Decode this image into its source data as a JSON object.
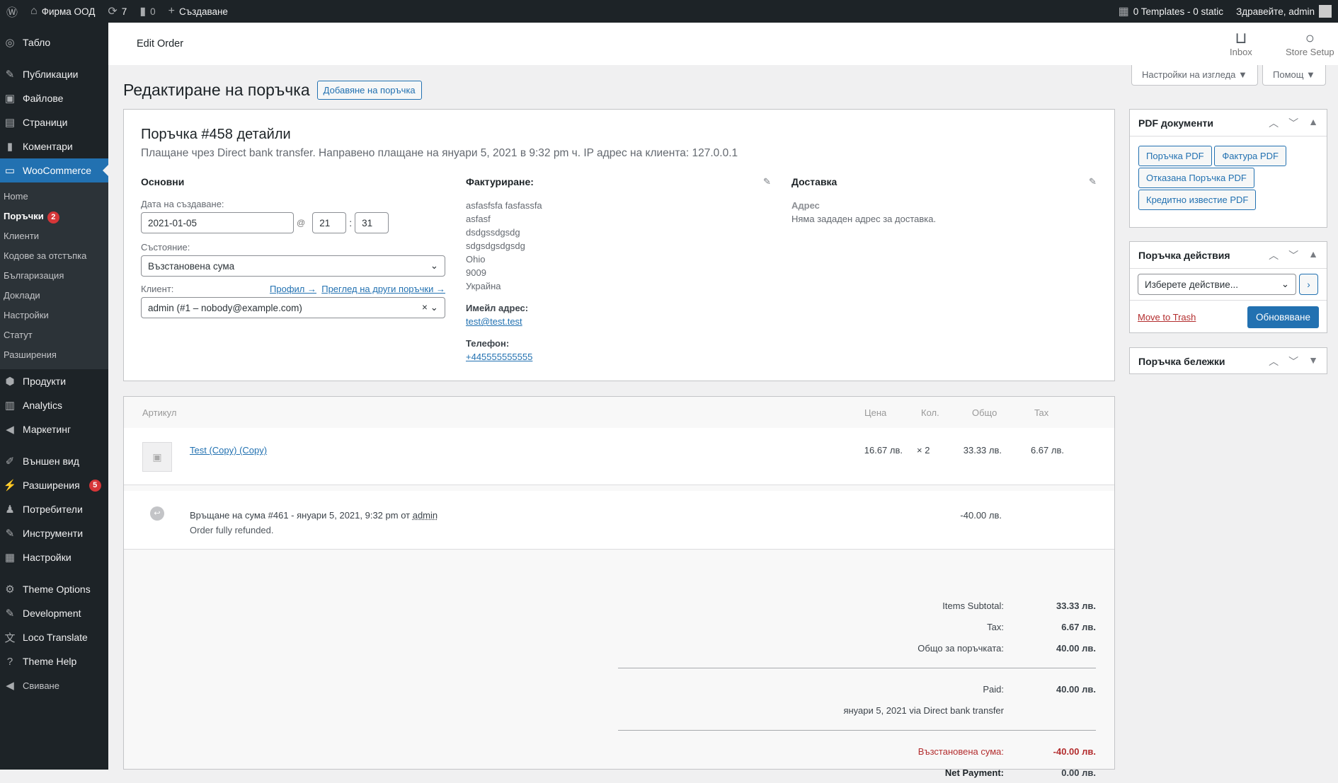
{
  "adminbar": {
    "site": "Фирма ООД",
    "updates": "7",
    "comments": "0",
    "new": "Създаване",
    "templates": "0 Templates - 0 static",
    "greeting": "Здравейте, admin"
  },
  "sidebar": {
    "top": [
      {
        "label": "Табло",
        "icon": "dashboard-icon"
      }
    ],
    "group1": [
      {
        "label": "Публикации",
        "icon": "pin-icon"
      },
      {
        "label": "Файлове",
        "icon": "media-icon"
      },
      {
        "label": "Страници",
        "icon": "page-icon"
      },
      {
        "label": "Коментари",
        "icon": "comment-icon"
      }
    ],
    "woo": "WooCommerce",
    "sub": [
      {
        "label": "Home"
      },
      {
        "label": "Поръчки",
        "badge": "2"
      },
      {
        "label": "Клиенти"
      },
      {
        "label": "Кодове за отстъпка"
      },
      {
        "label": "Българизация"
      },
      {
        "label": "Доклади"
      },
      {
        "label": "Настройки"
      },
      {
        "label": "Статут"
      },
      {
        "label": "Разширения"
      }
    ],
    "group2": [
      {
        "label": "Продукти"
      },
      {
        "label": "Analytics"
      },
      {
        "label": "Маркетинг"
      }
    ],
    "group3": [
      {
        "label": "Външен вид"
      },
      {
        "label": "Разширения",
        "badge": "5"
      },
      {
        "label": "Потребители"
      },
      {
        "label": "Инструменти"
      },
      {
        "label": "Настройки"
      }
    ],
    "group4": [
      {
        "label": "Theme Options"
      },
      {
        "label": "Development"
      },
      {
        "label": "Loco Translate"
      },
      {
        "label": "Theme Help"
      }
    ],
    "collapse": "Свиване"
  },
  "header": {
    "title": "Edit Order",
    "inbox": "Inbox",
    "store_setup": "Store Setup",
    "screen_options": "Настройки на изгледа ▼",
    "help": "Помощ ▼"
  },
  "page": {
    "title": "Редактиране на поръчка",
    "add_button": "Добавяне на поръчка"
  },
  "order": {
    "heading": "Поръчка #458 детайли",
    "meta": "Плащане чрез Direct bank transfer. Направено плащане на януари 5, 2021 в 9:32 pm ч. IP адрес на клиента: 127.0.0.1",
    "general": {
      "title": "Основни",
      "date_label": "Дата на създаване:",
      "date": "2021-01-05",
      "at": "@",
      "hour": "21",
      "colon": ":",
      "minute": "31",
      "status_label": "Състояние:",
      "status": "Възстановена сума",
      "customer_label": "Клиент:",
      "profile_link": "Профил →",
      "other_orders_link": "Преглед на други поръчки →",
      "customer": "admin (#1 – nobody@example.com)"
    },
    "billing": {
      "title": "Фактуриране:",
      "lines": [
        "asfasfsfa fasfassfa",
        "asfasf",
        "dsdgssdgsdg",
        "sdgsdgsdgsdg",
        "Ohio",
        "9009",
        "Украйна"
      ],
      "email_label": "Имейл адрес:",
      "email": "test@test.test",
      "phone_label": "Телефон:",
      "phone": "+445555555555"
    },
    "shipping": {
      "title": "Доставка",
      "address_label": "Адрес",
      "address": "Няма зададен адрес за доставка."
    }
  },
  "items": {
    "headers": {
      "item": "Артикул",
      "price": "Цена",
      "qty": "Кол.",
      "total": "Общо",
      "tax": "Tax"
    },
    "rows": [
      {
        "name": "Test (Copy) (Copy)",
        "price": "16.67 лв.",
        "qty": "× 2",
        "total": "33.33 лв.",
        "tax": "6.67 лв."
      }
    ],
    "refund": {
      "text": "Връщане на сума #461 - януари 5, 2021, 9:32 pm от",
      "by": "admin",
      "note": "Order fully refunded.",
      "amount": "-40.00 лв."
    },
    "totals": {
      "subtotal_label": "Items Subtotal:",
      "subtotal": "33.33 лв.",
      "tax_label": "Tax:",
      "tax": "6.67 лв.",
      "order_total_label": "Общо за поръчката:",
      "order_total": "40.00 лв.",
      "paid_label": "Paid:",
      "paid": "40.00 лв.",
      "paid_via": "януари 5, 2021 via Direct bank transfer",
      "refunded_label": "Възстановена сума:",
      "refunded": "-40.00 лв.",
      "net_label": "Net Payment:",
      "net": "0.00 лв."
    }
  },
  "pdf": {
    "title": "PDF документи",
    "buttons": [
      "Поръчка PDF",
      "Фактура PDF",
      "Отказана Поръчка PDF",
      "Кредитно известие PDF"
    ]
  },
  "actions": {
    "title": "Поръчка действия",
    "select": "Изберете действие...",
    "go": "›",
    "trash": "Move to Trash",
    "update": "Обновяване"
  },
  "notes": {
    "title": "Поръчка бележки"
  },
  "colors": {
    "accent": "#2271b1",
    "danger": "#b32d2e",
    "adminbar": "#1d2327"
  }
}
